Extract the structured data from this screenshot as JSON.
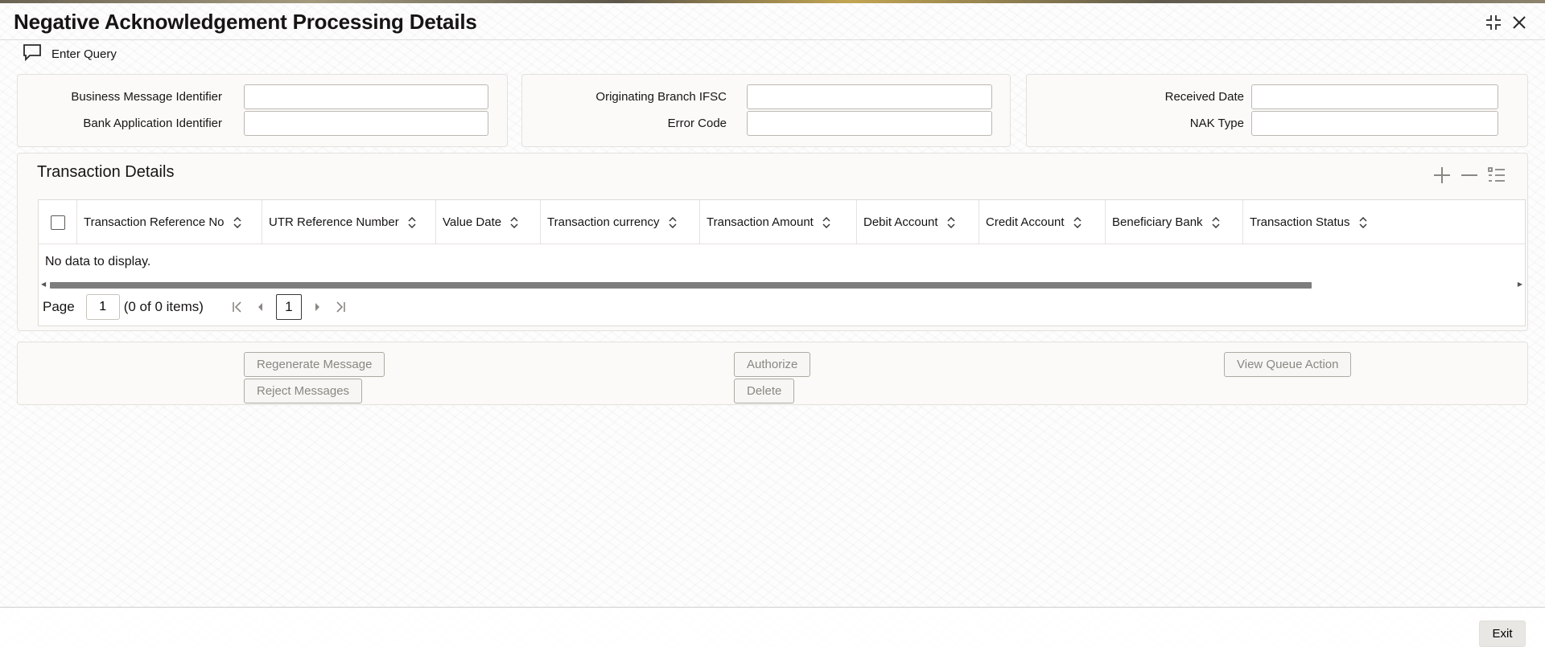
{
  "window": {
    "title": "Negative Acknowledgement Processing Details"
  },
  "toolbar": {
    "enter_query": "Enter Query"
  },
  "criteria": {
    "business_message_identifier": {
      "label": "Business Message Identifier",
      "value": ""
    },
    "bank_application_identifier": {
      "label": "Bank Application Identifier",
      "value": ""
    },
    "originating_branch_ifsc": {
      "label": "Originating Branch IFSC",
      "value": ""
    },
    "error_code": {
      "label": "Error Code",
      "value": ""
    },
    "received_date": {
      "label": "Received Date",
      "value": ""
    },
    "nak_type": {
      "label": "NAK Type",
      "value": ""
    }
  },
  "transaction_details": {
    "title": "Transaction Details",
    "columns": [
      "Transaction Reference No",
      "UTR Reference Number",
      "Value Date",
      "Transaction currency",
      "Transaction Amount",
      "Debit Account",
      "Credit Account",
      "Beneficiary Bank",
      "Transaction Status"
    ],
    "empty_message": "No data to display.",
    "pager": {
      "page_label": "Page",
      "page_value": "1",
      "items_text": "(0 of 0 items)",
      "current_page": "1"
    }
  },
  "actions": {
    "regenerate_message": "Regenerate Message",
    "reject_messages": "Reject Messages",
    "authorize": "Authorize",
    "delete": "Delete",
    "view_queue_action": "View Queue Action"
  },
  "footer": {
    "exit": "Exit"
  },
  "icons": {
    "restore": "restore-icon",
    "close": "close-icon",
    "query": "chat-bubble-icon",
    "add": "plus-icon",
    "remove": "minus-icon",
    "columns": "list-settings-icon",
    "sort": "sort-icon"
  }
}
